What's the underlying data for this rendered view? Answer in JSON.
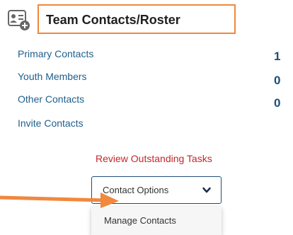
{
  "header": {
    "icon": "contacts-add-icon",
    "title": "Team Contacts/Roster"
  },
  "contacts": [
    {
      "label": "Primary Contacts",
      "count": "1"
    },
    {
      "label": "Youth Members",
      "count": "0"
    },
    {
      "label": "Other Contacts",
      "count": "0"
    },
    {
      "label": "Invite Contacts",
      "count": null
    }
  ],
  "review_link": "Review Outstanding Tasks",
  "dropdown": {
    "label": "Contact Options",
    "icon": "chevron-down-icon",
    "menu_items": [
      "Manage Contacts"
    ]
  },
  "annotation": {
    "icon": "arrow-icon",
    "color": "#f0883e"
  },
  "colors": {
    "highlight_border": "#f0883e",
    "link": "#1f5f8b",
    "count": "#1b4f7a",
    "alert": "#c1272d",
    "dropdown_border": "#1f4e79"
  }
}
